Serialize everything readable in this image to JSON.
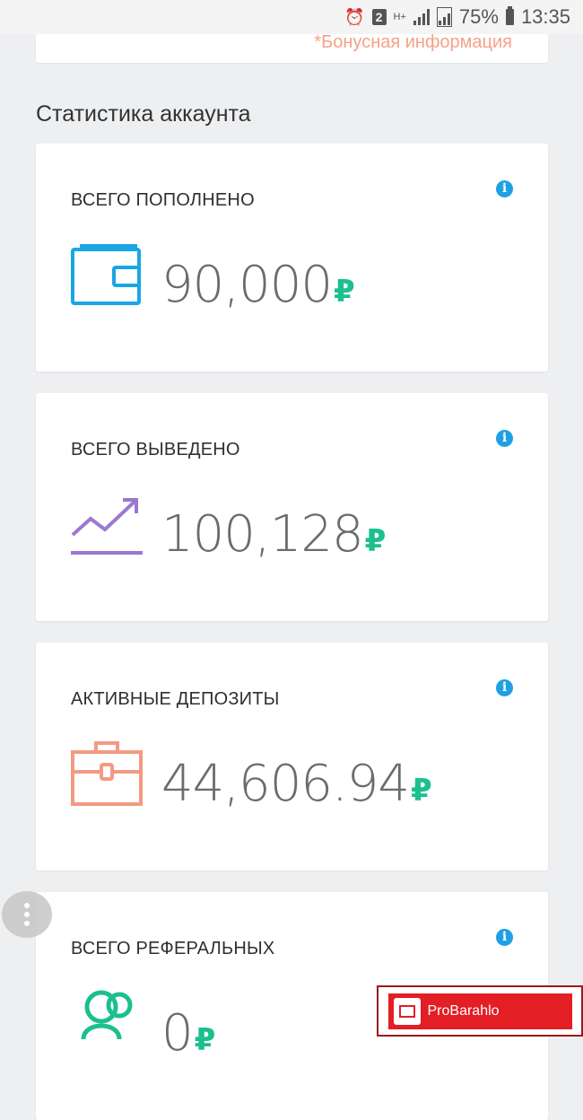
{
  "status_bar": {
    "sim_badge": "2",
    "network": "H+",
    "battery": "75%",
    "time": "13:35"
  },
  "top_card": {
    "bonus_link": "*Бонусная информация"
  },
  "section_title": "Статистика аккаунта",
  "cards": [
    {
      "label": "ВСЕГО ПОПОЛНЕНО",
      "amount": "90,000",
      "currency": "₽",
      "icon": "wallet-icon",
      "icon_color": "#1aa6e6"
    },
    {
      "label": "ВСЕГО ВЫВЕДЕНО",
      "amount": "100,128",
      "currency": "₽",
      "icon": "trend-up-icon",
      "icon_color": "#9b78d2"
    },
    {
      "label": "АКТИВНЫЕ ДЕПОЗИТЫ",
      "amount": "44,606.94",
      "currency": "₽",
      "icon": "briefcase-icon",
      "icon_color": "#f39a83"
    },
    {
      "label": "ВСЕГО РЕФЕРАЛЬНЫХ",
      "amount": "0",
      "currency": "₽",
      "icon": "referrals-icon",
      "icon_color": "#1cbf8e"
    }
  ],
  "info_glyph": "i",
  "watermark": {
    "text": "ProBarahlo"
  },
  "colors": {
    "accent_green": "#1cbf8e",
    "info_blue": "#1fa0e4",
    "bonus_orange": "#f6a185"
  }
}
